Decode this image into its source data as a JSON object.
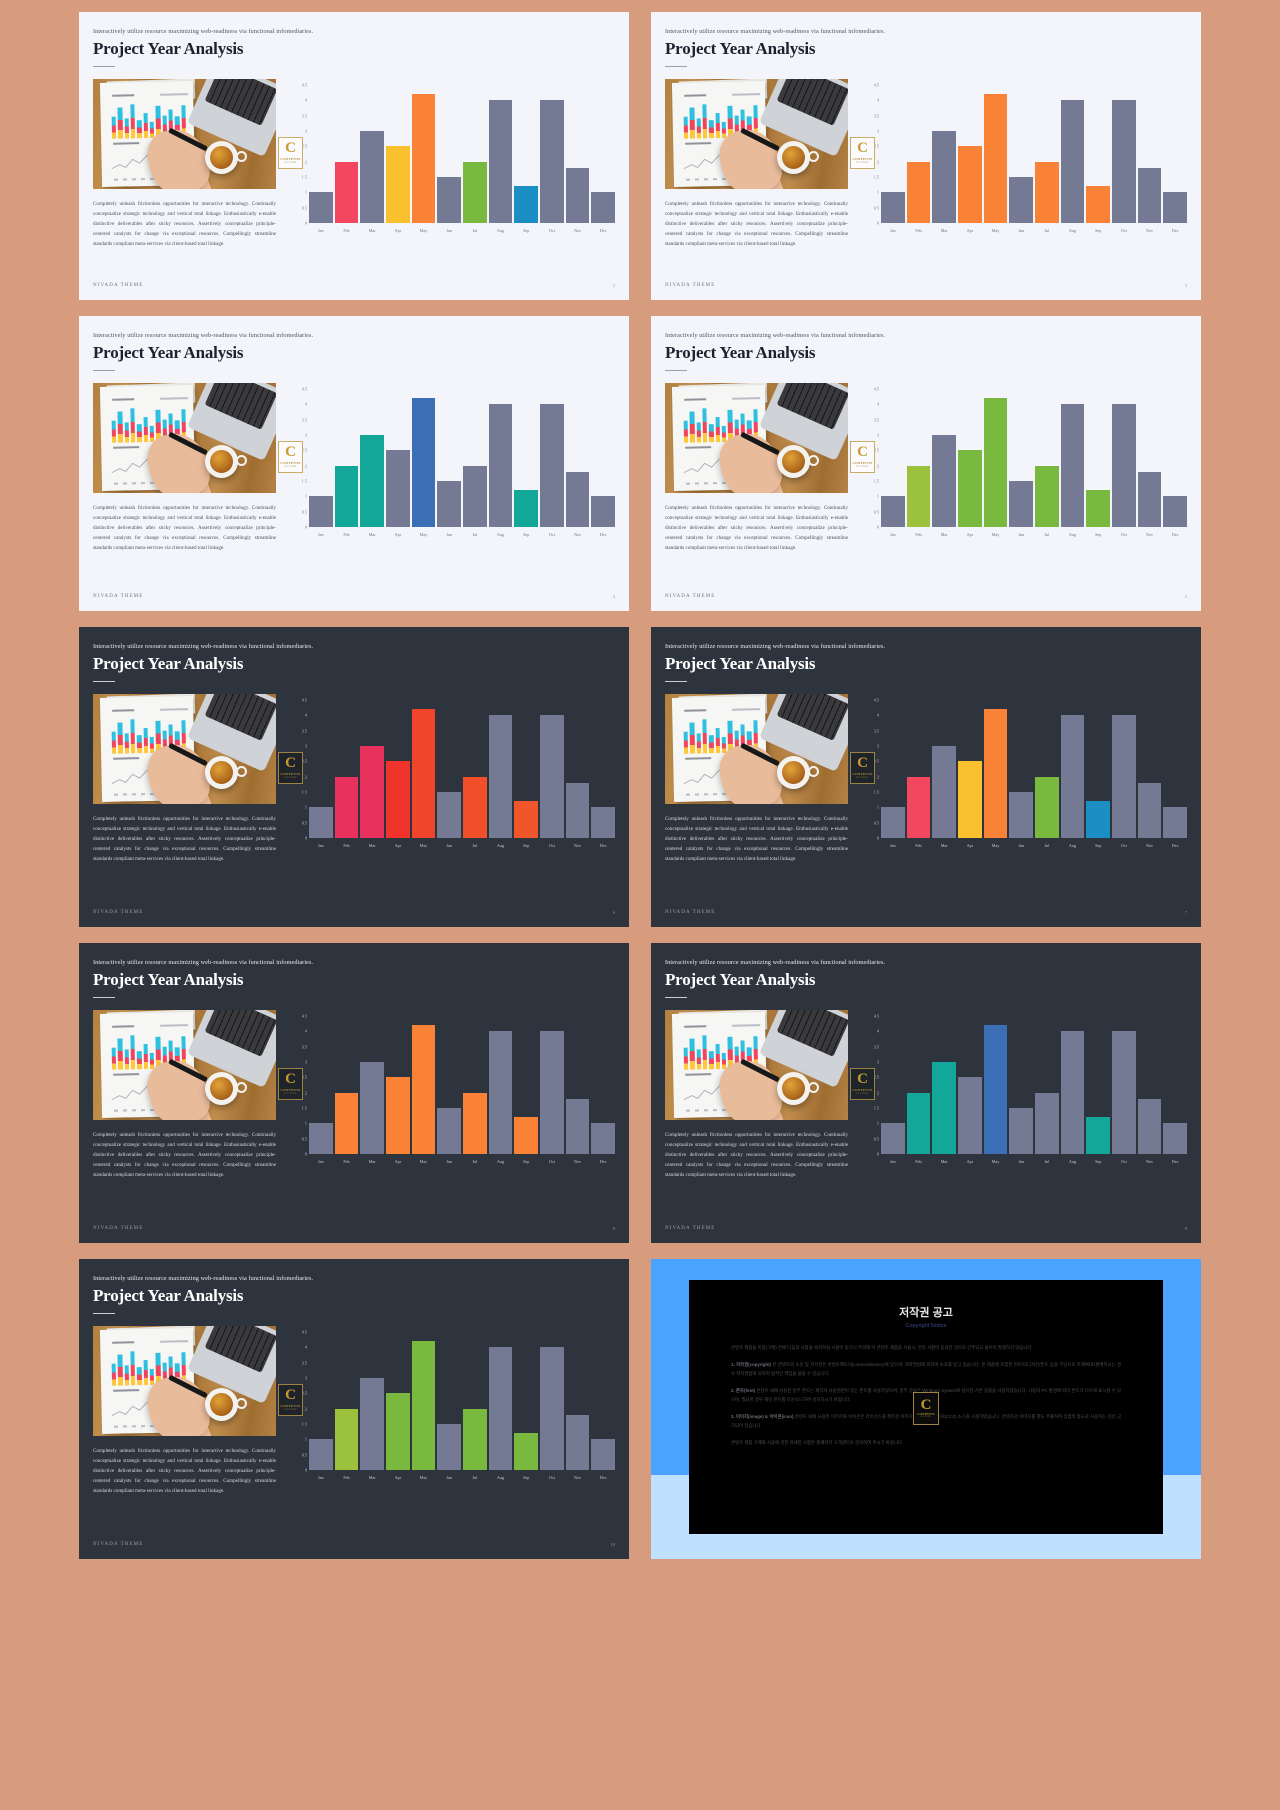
{
  "deck": {
    "brand": "NIVADA THEME",
    "eyebrow": "Interactively utilize resource maximizing web-readiness via functional infomediaries.",
    "title": "Project Year Analysis",
    "paragraph": "Completely unleash frictionless opportunities for interactive technology. Continually conceptualize strategic technology and vertical total linkage. Enthusiastically e-enable distinctive deliverables after sticky resources. Assertively conceptualize principle-centered catalysts for change via exceptional resources. Compellingly streamline standards compliant meta-services via client-based total linkage.",
    "badge": {
      "letter": "C",
      "sup": "2",
      "name": "CONTENTS",
      "sub": "FACTORY"
    }
  },
  "chart_data": {
    "type": "bar",
    "title": "Project Year Analysis",
    "xlabel": "",
    "ylabel": "",
    "ylim": [
      0,
      4.5
    ],
    "grid": false,
    "legend": "none",
    "categories": [
      "Jan",
      "Feb",
      "Mar",
      "Apr",
      "May",
      "Jun",
      "Jul",
      "Aug",
      "Sep",
      "Oct",
      "Nov",
      "Dec"
    ],
    "yticks": [
      "4.5",
      "4",
      "3.5",
      "3",
      "2.5",
      "2",
      "1.5",
      "1",
      "0.5",
      "0"
    ],
    "ytick_values": [
      4.5,
      4,
      3.5,
      3,
      2.5,
      2,
      1.5,
      1,
      0.5,
      0
    ],
    "values": [
      1,
      2,
      3,
      2.5,
      4.2,
      1.5,
      2,
      4,
      1.2,
      4,
      1.8,
      1
    ]
  },
  "palettes": {
    "neutral": "#747a93",
    "slide1": [
      "#747a93",
      "#f2475f",
      "#747a93",
      "#fbc02d",
      "#f98236",
      "#747a93",
      "#7ab93f",
      "#747a93",
      "#1b8fc4",
      "#747a93",
      "#747a93",
      "#747a93"
    ],
    "slide2": [
      "#747a93",
      "#f98236",
      "#747a93",
      "#f98236",
      "#f98236",
      "#747a93",
      "#f98236",
      "#747a93",
      "#f98236",
      "#747a93",
      "#747a93",
      "#747a93"
    ],
    "slide3": [
      "#747a93",
      "#13a79a",
      "#13a79a",
      "#747a93",
      "#3a6fb5",
      "#747a93",
      "#747a93",
      "#747a93",
      "#13a79a",
      "#747a93",
      "#747a93",
      "#747a93"
    ],
    "slide4": [
      "#747a93",
      "#9cc23d",
      "#747a93",
      "#7ab93f",
      "#7ab93f",
      "#747a93",
      "#7ab93f",
      "#747a93",
      "#7ab93f",
      "#747a93",
      "#747a93",
      "#747a93"
    ],
    "slide5": [
      "#747a93",
      "#e8315c",
      "#e8315c",
      "#f0342c",
      "#f0452a",
      "#747a93",
      "#f04f2a",
      "#747a93",
      "#f0562a",
      "#747a93",
      "#747a93",
      "#747a93"
    ],
    "slide6": [
      "#747a93",
      "#f2475f",
      "#747a93",
      "#fbc02d",
      "#f98236",
      "#747a93",
      "#7ab93f",
      "#747a93",
      "#1b8fc4",
      "#747a93",
      "#747a93",
      "#747a93"
    ],
    "slide7": [
      "#747a93",
      "#f98236",
      "#747a93",
      "#f98236",
      "#f98236",
      "#747a93",
      "#f98236",
      "#747a93",
      "#f98236",
      "#747a93",
      "#747a93",
      "#747a93"
    ],
    "slide8": [
      "#747a93",
      "#13a79a",
      "#13a79a",
      "#747a93",
      "#3a6fb5",
      "#747a93",
      "#747a93",
      "#747a93",
      "#13a79a",
      "#747a93",
      "#747a93",
      "#747a93"
    ],
    "slide9": [
      "#747a93",
      "#9cc23d",
      "#747a93",
      "#7ab93f",
      "#7ab93f",
      "#747a93",
      "#7ab93f",
      "#747a93",
      "#7ab93f",
      "#747a93",
      "#747a93",
      "#747a93"
    ]
  },
  "slides": [
    {
      "page": "2",
      "theme": "light",
      "palette": "slide1"
    },
    {
      "page": "3",
      "theme": "light",
      "palette": "slide2"
    },
    {
      "page": "4",
      "theme": "light",
      "palette": "slide3"
    },
    {
      "page": "5",
      "theme": "light",
      "palette": "slide4"
    },
    {
      "page": "6",
      "theme": "dark",
      "palette": "slide5"
    },
    {
      "page": "7",
      "theme": "dark",
      "palette": "slide6"
    },
    {
      "page": "8",
      "theme": "dark",
      "palette": "slide7"
    },
    {
      "page": "9",
      "theme": "dark",
      "palette": "slide8"
    },
    {
      "page": "10",
      "theme": "dark",
      "palette": "slide9"
    }
  ],
  "copyright": {
    "title": "저작권 공고",
    "subtitle": "Copyright Notice",
    "intro": "콘텐츠 제품을 이용(구매) 전에 다음의 사항을 숙지하실 사항이 있으니 주의해 이 콘텐츠 제품을 사용시, 본문 사항이 동의한 것으로 간주되고 불이익 발생하지 않습니다.",
    "items": [
      {
        "head": "1. 저작권(copyright)",
        "text": "본 콘텐츠의 소유 및 저작권은 콘텐츠팩토리(contentsfactory)에 있으며, 저작권법에 의하여 보호를 받고 있습니다. 본 제품에 포함된 이미지/디자인/폰트 등을 무단으로 복제/배포/판매하시는 경우 저작권법에 의하여 법적인 책임을 물을 수 있습니다."
      },
      {
        "head": "2. 폰트(font)",
        "text": "콘텐츠 내에 사용된 일부 폰트는 제작자 사용권한이 있는 폰트를 사용하였으며, 일부 글꼴은 Windows System에 설치된 기본 글꼴을 사용하였습니다. 사용자 PC 환경에 따라 폰트가 다르게 표시될 수 있으며, 필요한 경우 해당 폰트를 다운로드하여 설치하시기 바랍니다."
      },
      {
        "head": "3. 이미지(image) & 아이콘(icon)",
        "text": "콘텐츠 내에 사용된 이미지와 아이콘은 라이선스를 취득한 이미지 또는 무료 이미지(CC0) 소스를 사용하였습니다. 콘텐츠의 이미지를 별도 추출하여 상업적 용도로 사용하는 것은 금지되어 있습니다."
      },
      {
        "head": "",
        "text": "콘텐츠 제품 구매와 사용에 관한 자세한 사항은 홈페이지 고객센터로 문의하여 주시기 바랍니다."
      }
    ]
  }
}
